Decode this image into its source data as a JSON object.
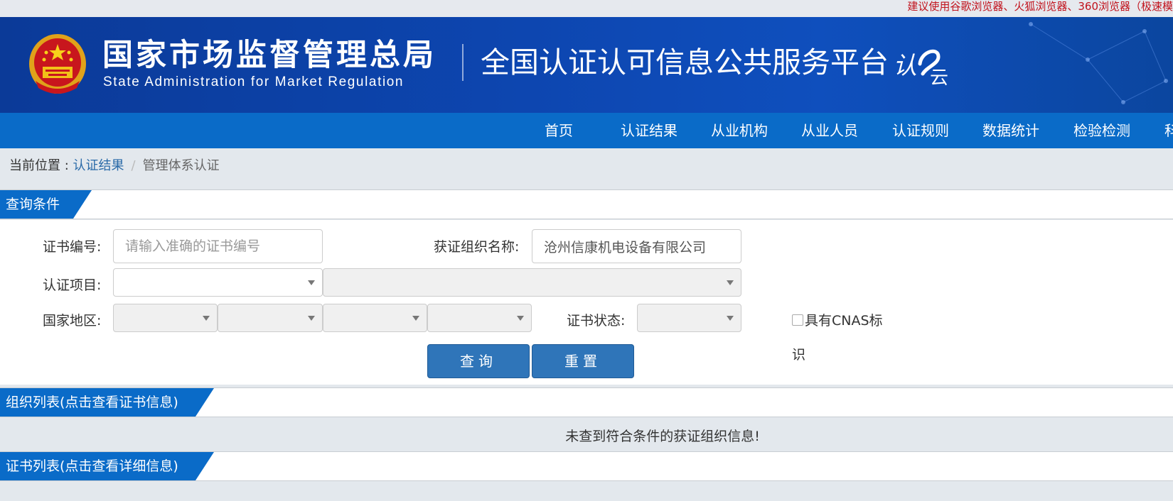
{
  "notice": "建议使用谷歌浏览器、火狐浏览器、360浏览器（极速模",
  "header": {
    "org_cn": "国家市场监督管理总局",
    "org_en": "State Administration  for  Market Regulation",
    "platform_title": "全国认证认可信息公共服务平台",
    "logo_text": "认云"
  },
  "nav": {
    "items": [
      "首页",
      "认证结果",
      "从业机构",
      "从业人员",
      "认证规则",
      "数据统计",
      "检验检测",
      "科"
    ]
  },
  "breadcrumb": {
    "prefix": "当前位置 : ",
    "link": "认证结果",
    "separator": "/",
    "current": "管理体系认证"
  },
  "query": {
    "section_title": "查询条件",
    "cert_no_label": "证书编号:",
    "cert_no_placeholder": "请输入准确的证书编号",
    "org_name_label": "获证组织名称:",
    "org_name_value": "沧州信康机电设备有限公司",
    "project_label": "认证项目:",
    "region_label": "国家地区:",
    "status_label": "证书状态:",
    "cnas_label_1": "具有CNAS标",
    "cnas_label_2": "识",
    "search_button": "查询",
    "reset_button": "重置"
  },
  "org_list": {
    "title": "组织列表(点击查看证书信息)",
    "empty_message": "未查到符合条件的获证组织信息!"
  },
  "cert_list": {
    "title": "证书列表(点击查看详细信息)"
  },
  "colors": {
    "banner": "#0d46b0",
    "nav": "#0a6bc8",
    "button": "#2f75b9",
    "notice": "#c1121c"
  }
}
